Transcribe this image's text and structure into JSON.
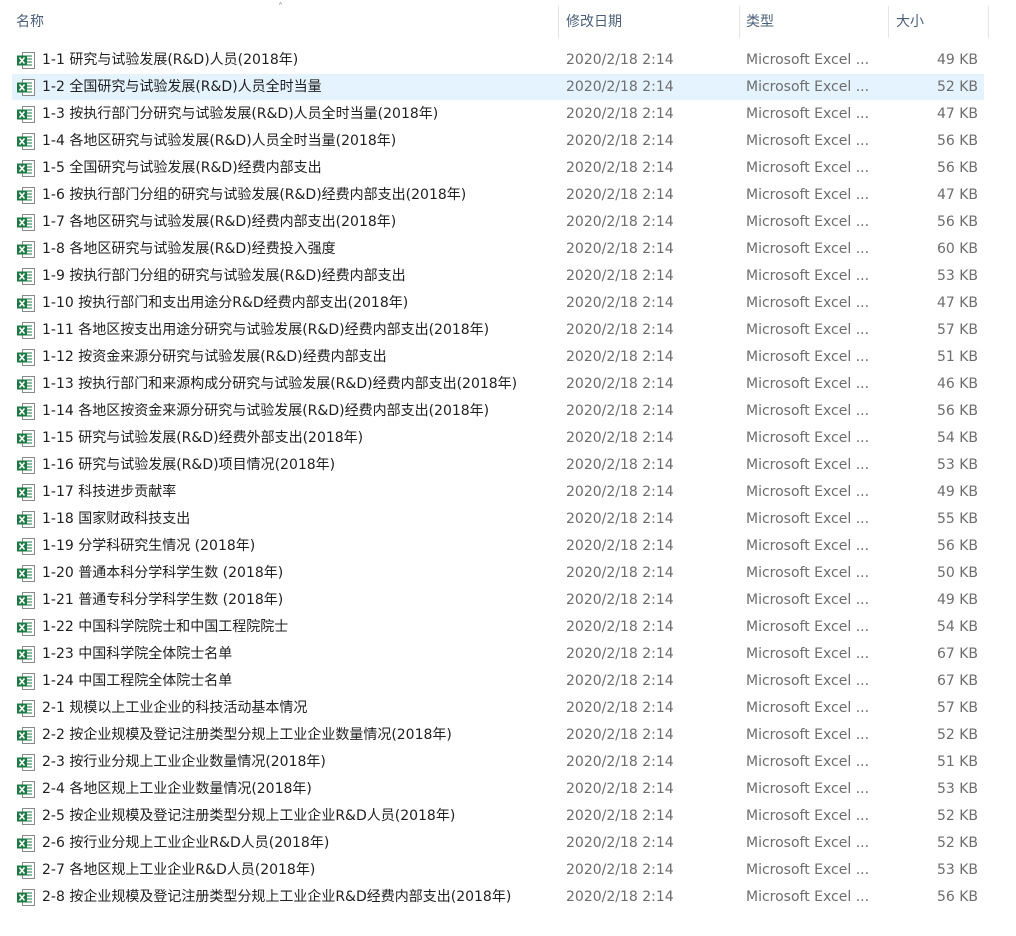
{
  "columns": {
    "name": "名称",
    "date": "修改日期",
    "type": "类型",
    "size": "大小"
  },
  "selected_index": 1,
  "colors": {
    "selection": "#e5f3ff",
    "excel_green": "#1d7a45"
  },
  "files": [
    {
      "name": "1-1  研究与试验发展(R&D)人员(2018年)",
      "date": "2020/2/18 2:14",
      "type": "Microsoft Excel ...",
      "size": "49 KB"
    },
    {
      "name": "1-2  全国研究与试验发展(R&D)人员全时当量",
      "date": "2020/2/18 2:14",
      "type": "Microsoft Excel ...",
      "size": "52 KB"
    },
    {
      "name": "1-3  按执行部门分研究与试验发展(R&D)人员全时当量(2018年)",
      "date": "2020/2/18 2:14",
      "type": "Microsoft Excel ...",
      "size": "47 KB"
    },
    {
      "name": "1-4  各地区研究与试验发展(R&D)人员全时当量(2018年)",
      "date": "2020/2/18 2:14",
      "type": "Microsoft Excel ...",
      "size": "56 KB"
    },
    {
      "name": "1-5  全国研究与试验发展(R&D)经费内部支出",
      "date": "2020/2/18 2:14",
      "type": "Microsoft Excel ...",
      "size": "56 KB"
    },
    {
      "name": "1-6  按执行部门分组的研究与试验发展(R&D)经费内部支出(2018年)",
      "date": "2020/2/18 2:14",
      "type": "Microsoft Excel ...",
      "size": "47 KB"
    },
    {
      "name": "1-7  各地区研究与试验发展(R&D)经费内部支出(2018年)",
      "date": "2020/2/18 2:14",
      "type": "Microsoft Excel ...",
      "size": "56 KB"
    },
    {
      "name": "1-8  各地区研究与试验发展(R&D)经费投入强度",
      "date": "2020/2/18 2:14",
      "type": "Microsoft Excel ...",
      "size": "60 KB"
    },
    {
      "name": "1-9  按执行部门分组的研究与试验发展(R&D)经费内部支出",
      "date": "2020/2/18 2:14",
      "type": "Microsoft Excel ...",
      "size": "53 KB"
    },
    {
      "name": "1-10  按执行部门和支出用途分R&D经费内部支出(2018年)",
      "date": "2020/2/18 2:14",
      "type": "Microsoft Excel ...",
      "size": "47 KB"
    },
    {
      "name": "1-11  各地区按支出用途分研究与试验发展(R&D)经费内部支出(2018年)",
      "date": "2020/2/18 2:14",
      "type": "Microsoft Excel ...",
      "size": "57 KB"
    },
    {
      "name": "1-12  按资金来源分研究与试验发展(R&D)经费内部支出",
      "date": "2020/2/18 2:14",
      "type": "Microsoft Excel ...",
      "size": "51 KB"
    },
    {
      "name": "1-13  按执行部门和来源构成分研究与试验发展(R&D)经费内部支出(2018年)",
      "date": "2020/2/18 2:14",
      "type": "Microsoft Excel ...",
      "size": "46 KB"
    },
    {
      "name": "1-14  各地区按资金来源分研究与试验发展(R&D)经费内部支出(2018年)",
      "date": "2020/2/18 2:14",
      "type": "Microsoft Excel ...",
      "size": "56 KB"
    },
    {
      "name": "1-15  研究与试验发展(R&D)经费外部支出(2018年)",
      "date": "2020/2/18 2:14",
      "type": "Microsoft Excel ...",
      "size": "54 KB"
    },
    {
      "name": "1-16  研究与试验发展(R&D)项目情况(2018年)",
      "date": "2020/2/18 2:14",
      "type": "Microsoft Excel ...",
      "size": "53 KB"
    },
    {
      "name": "1-17  科技进步贡献率",
      "date": "2020/2/18 2:14",
      "type": "Microsoft Excel ...",
      "size": "49 KB"
    },
    {
      "name": "1-18  国家财政科技支出",
      "date": "2020/2/18 2:14",
      "type": "Microsoft Excel ...",
      "size": "55 KB"
    },
    {
      "name": "1-19  分学科研究生情况 (2018年)",
      "date": "2020/2/18 2:14",
      "type": "Microsoft Excel ...",
      "size": "56 KB"
    },
    {
      "name": "1-20  普通本科分学科学生数 (2018年)",
      "date": "2020/2/18 2:14",
      "type": "Microsoft Excel ...",
      "size": "50 KB"
    },
    {
      "name": "1-21  普通专科分学科学生数 (2018年)",
      "date": "2020/2/18 2:14",
      "type": "Microsoft Excel ...",
      "size": "49 KB"
    },
    {
      "name": "1-22  中国科学院院士和中国工程院院士",
      "date": "2020/2/18 2:14",
      "type": "Microsoft Excel ...",
      "size": "54 KB"
    },
    {
      "name": "1-23  中国科学院全体院士名单",
      "date": "2020/2/18 2:14",
      "type": "Microsoft Excel ...",
      "size": "67 KB"
    },
    {
      "name": "1-24  中国工程院全体院士名单",
      "date": "2020/2/18 2:14",
      "type": "Microsoft Excel ...",
      "size": "67 KB"
    },
    {
      "name": "2-1  规模以上工业企业的科技活动基本情况",
      "date": "2020/2/18 2:14",
      "type": "Microsoft Excel ...",
      "size": "57 KB"
    },
    {
      "name": "2-2  按企业规模及登记注册类型分规上工业企业数量情况(2018年)",
      "date": "2020/2/18 2:14",
      "type": "Microsoft Excel ...",
      "size": "52 KB"
    },
    {
      "name": "2-3  按行业分规上工业企业数量情况(2018年)",
      "date": "2020/2/18 2:14",
      "type": "Microsoft Excel ...",
      "size": "51 KB"
    },
    {
      "name": "2-4  各地区规上工业企业数量情况(2018年)",
      "date": "2020/2/18 2:14",
      "type": "Microsoft Excel ...",
      "size": "53 KB"
    },
    {
      "name": "2-5  按企业规模及登记注册类型分规上工业企业R&D人员(2018年)",
      "date": "2020/2/18 2:14",
      "type": "Microsoft Excel ...",
      "size": "52 KB"
    },
    {
      "name": "2-6  按行业分规上工业企业R&D人员(2018年)",
      "date": "2020/2/18 2:14",
      "type": "Microsoft Excel ...",
      "size": "52 KB"
    },
    {
      "name": "2-7  各地区规上工业企业R&D人员(2018年)",
      "date": "2020/2/18 2:14",
      "type": "Microsoft Excel ...",
      "size": "53 KB"
    },
    {
      "name": "2-8  按企业规模及登记注册类型分规上工业企业R&D经费内部支出(2018年)",
      "date": "2020/2/18 2:14",
      "type": "Microsoft Excel ...",
      "size": "56 KB"
    }
  ]
}
